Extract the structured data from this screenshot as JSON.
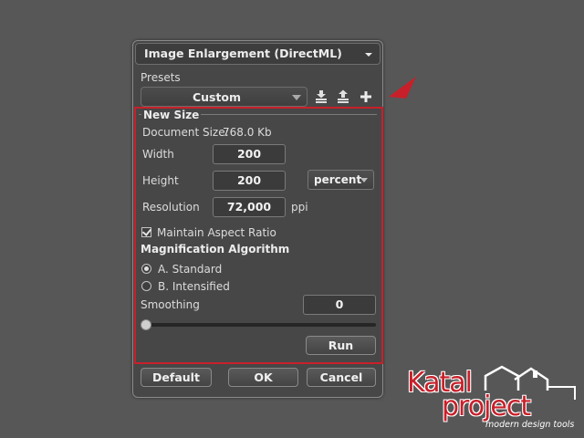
{
  "dialog": {
    "title": "Image Enlargement (DirectML)",
    "presets_label": "Presets",
    "preset_value": "Custom",
    "tools": [
      "save-preset-icon",
      "load-preset-icon",
      "add-preset-icon"
    ]
  },
  "new_size": {
    "group_title": "New Size",
    "document_size_label": "Document Size:",
    "document_size_value": "768.0 Kb",
    "width_label": "Width",
    "width_value": "200",
    "height_label": "Height",
    "height_value": "200",
    "unit_value": "percent",
    "resolution_label": "Resolution",
    "resolution_value": "72,000",
    "resolution_unit": "ppi"
  },
  "options": {
    "maintain_aspect_label": "Maintain Aspect Ratio",
    "maintain_aspect_checked": true,
    "algorithm_title": "Magnification Algorithm",
    "algorithm_a": "A. Standard",
    "algorithm_b": "B. Intensified",
    "selected_algorithm": "A. Standard",
    "smoothing_label": "Smoothing",
    "smoothing_value": "0",
    "smoothing_fraction": 0,
    "run_label": "Run"
  },
  "footer": {
    "default_label": "Default",
    "ok_label": "OK",
    "cancel_label": "Cancel"
  },
  "watermark": {
    "line1": "Katal",
    "line2": "project",
    "tagline": "modern design tools"
  },
  "colors": {
    "highlight": "#c8202a",
    "background": "#575757",
    "panel": "#474747"
  }
}
